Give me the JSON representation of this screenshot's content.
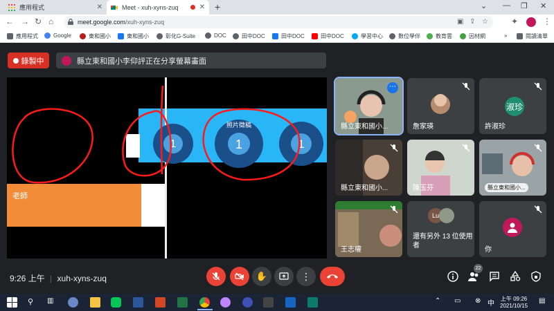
{
  "browser": {
    "tabs": [
      {
        "label": "應用程式"
      },
      {
        "label": "Meet - xuh-xyns-zuq"
      }
    ],
    "url": {
      "host": "meet.google.com",
      "path": "/xuh-xyns-zuq"
    },
    "bookmarks": [
      {
        "label": "應用程式",
        "color": "#5f6368"
      },
      {
        "label": "Google",
        "color": "#4285f4"
      },
      {
        "label": "東和國小",
        "color": "#b71c1c"
      },
      {
        "label": "東和國小",
        "color": "#1877f2"
      },
      {
        "label": "彰化G-Suite",
        "color": "#5f6368"
      },
      {
        "label": "DOC",
        "color": "#5f6368"
      },
      {
        "label": "田中DOC",
        "color": "#5f6368"
      },
      {
        "label": "田中DOC",
        "color": "#1877f2"
      },
      {
        "label": "田中DOC",
        "color": "#ff0000"
      },
      {
        "label": "學習中心",
        "color": "#03a9f4"
      },
      {
        "label": "數位學伴",
        "color": "#5f6368"
      },
      {
        "label": "教育雲",
        "color": "#4caf50"
      },
      {
        "label": "因材網",
        "color": "#43a047"
      }
    ],
    "reading_list": "閱讀清單"
  },
  "meet": {
    "recording_label": "錄製中",
    "share_banner": "縣立東和國小李仰評正在分享螢幕畫面",
    "slide": {
      "orange_text": "老師",
      "circle_number": "1",
      "circle_text": "照片徵稿"
    },
    "participants": [
      {
        "name": "縣立東和國小...",
        "kind": "video",
        "active": true
      },
      {
        "name": "詹家瑛",
        "kind": "video"
      },
      {
        "name": "許淑珍",
        "kind": "initials",
        "initials": "淑珍",
        "color": "#1e8e6e"
      },
      {
        "name": "縣立東和國小...",
        "kind": "video"
      },
      {
        "name": "陳玉芬",
        "kind": "video"
      },
      {
        "name": "縣立東和國小...",
        "kind": "video"
      },
      {
        "name": "王志權",
        "kind": "video"
      },
      {
        "name": "還有另外 13 位使用者",
        "kind": "more",
        "initials": "Lu"
      },
      {
        "name": "你",
        "kind": "self"
      }
    ],
    "time": "9:26 上午",
    "meeting_code": "xuh-xyns-zuq",
    "people_count": "22"
  },
  "taskbar": {
    "time": "上午 09:26",
    "date": "2021/10/15"
  },
  "colors": {
    "meet_bg": "#202124",
    "red": "#ea4335",
    "tile_bg": "#3c4043"
  }
}
